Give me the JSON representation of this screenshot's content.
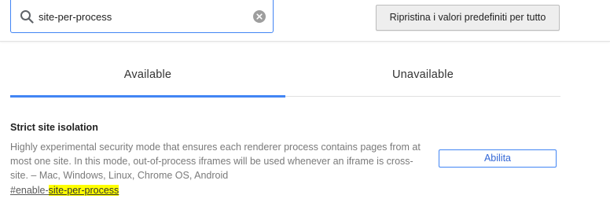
{
  "header": {
    "search": {
      "value": "site-per-process",
      "icon": "search-icon",
      "clear_icon": "clear-icon"
    },
    "reset_button_label": "Ripristina i valori predefiniti per tutto"
  },
  "tabs": [
    {
      "label": "Available",
      "selected": true
    },
    {
      "label": "Unavailable",
      "selected": false
    }
  ],
  "experiment": {
    "title": "Strict site isolation",
    "description": "Highly experimental security mode that ensures each renderer process contains pages from at most one site. In this mode, out-of-process iframes will be used whenever an iframe is cross-site.  – Mac, Windows, Linux, Chrome OS, Android",
    "link_prefix": "#enable-",
    "link_match": "site-per-process",
    "control_value": "Abilita"
  },
  "colors": {
    "accent": "#4285f4",
    "highlight": "#ffff00"
  }
}
